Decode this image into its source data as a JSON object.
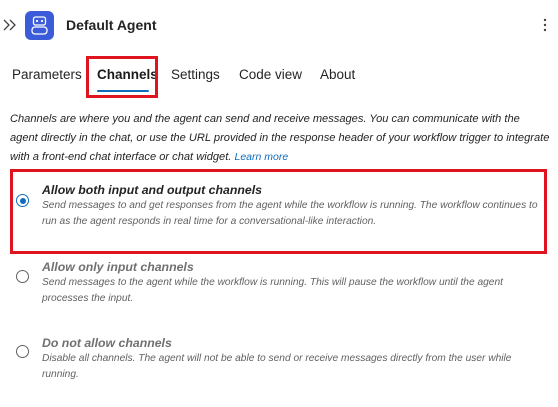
{
  "header": {
    "title": "Default Agent",
    "icons": {
      "expand": "double-chevron-right-icon",
      "agent": "robot-icon",
      "more": "more-vertical-icon"
    },
    "accent_color": "#3c5bd8"
  },
  "tabs": [
    {
      "label": "Parameters",
      "active": false
    },
    {
      "label": "Channels",
      "active": true
    },
    {
      "label": "Settings",
      "active": false
    },
    {
      "label": "Code view",
      "active": false
    },
    {
      "label": "About",
      "active": false
    }
  ],
  "description": {
    "text": "Channels are where you and the agent can send and receive messages. You can communicate with the agent directly in the chat, or use the URL provided in the response header of your workflow trigger to integrate with a front-end chat interface or chat widget.",
    "link": "Learn more"
  },
  "options": [
    {
      "title": "Allow both input and output channels",
      "description": "Send messages to and get responses from the agent while the workflow is running. The workflow continues to run as the agent responds in real time for a conversational-like interaction.",
      "selected": true
    },
    {
      "title": "Allow only input channels",
      "description": "Send messages to the agent while the workflow is running. This will pause the workflow until the agent processes the input.",
      "selected": false
    },
    {
      "title": "Do not allow channels",
      "description": "Disable all channels. The agent will not be able to send or receive messages directly from the user while running.",
      "selected": false
    }
  ],
  "colors": {
    "link": "#0f6cbd",
    "highlight": "#e0141e",
    "radio_selected": "#0f6cbd"
  }
}
